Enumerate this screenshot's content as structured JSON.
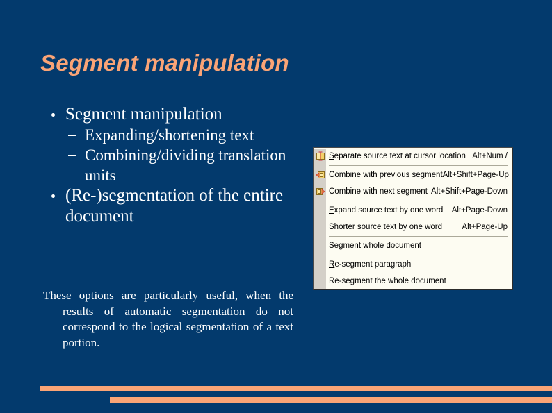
{
  "slide": {
    "title": "Segment manipulation",
    "background_color": "#033a6d",
    "accent_color": "#faa476",
    "text_color": "#ffffff"
  },
  "content": {
    "bullets": [
      {
        "text": "Segment manipulation",
        "sub": [
          "Expanding/shortening text",
          "Combining/dividing translation units"
        ]
      },
      {
        "text": "(Re-)segmentation of the entire document",
        "sub": []
      }
    ],
    "note": "These options are particularly useful, when the results of automatic segmentation do not correspond to the logical segmentation of a text portion."
  },
  "menu": {
    "background_color": "#fdfcf2",
    "gutter_color": "#d4d0c8",
    "groups": [
      {
        "items": [
          {
            "icon": "separate-segment-icon",
            "accel_char": "S",
            "label_rest": "eparate source text at cursor location",
            "label_full": "Separate source text at cursor location",
            "shortcut": "Alt+Num /"
          }
        ]
      },
      {
        "items": [
          {
            "icon": "combine-previous-icon",
            "accel_char": "C",
            "label_rest": "ombine with previous segment",
            "label_full": "Combine with previous segment",
            "shortcut": "Alt+Shift+Page-Up"
          },
          {
            "icon": "combine-next-icon",
            "accel_char": "",
            "label_rest": "Combine with next segment",
            "label_full": "Combine with next segment",
            "shortcut": "Alt+Shift+Page-Down"
          }
        ]
      },
      {
        "items": [
          {
            "icon": "",
            "accel_char": "E",
            "label_rest": "xpand source text by one word",
            "label_full": "Expand source text by one word",
            "shortcut": "Alt+Page-Down"
          },
          {
            "icon": "",
            "accel_char": "S",
            "label_rest": "horter source text by one word",
            "label_full": "Shorter source text by one word",
            "shortcut": "Alt+Page-Up"
          }
        ]
      },
      {
        "items": [
          {
            "icon": "",
            "accel_char": "",
            "label_rest": "Segment whole document",
            "label_full": "Segment whole document",
            "shortcut": ""
          }
        ]
      },
      {
        "items": [
          {
            "icon": "",
            "accel_char": "R",
            "label_rest": "e-segment paragraph",
            "label_full": "Re-segment paragraph",
            "shortcut": ""
          },
          {
            "icon": "",
            "accel_char": "",
            "label_rest": "Re-segment the whole document",
            "label_full": "Re-segment the whole document",
            "shortcut": ""
          }
        ]
      }
    ]
  }
}
